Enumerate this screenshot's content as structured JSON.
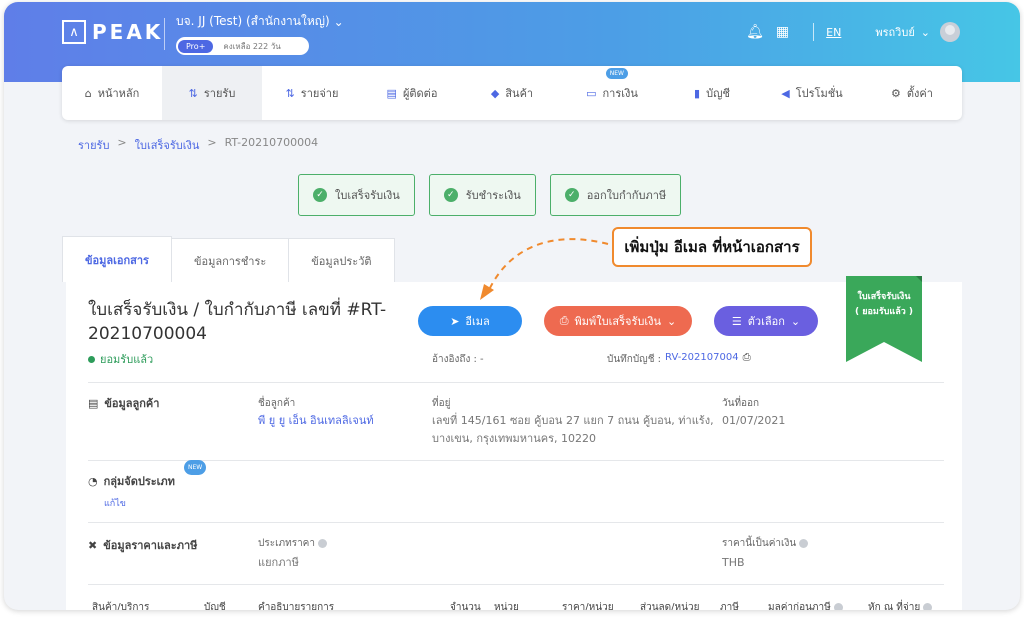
{
  "header": {
    "logo_text": "PEAK",
    "company_name": "บจ. JJ (Test) (สำนักงานใหญ่)",
    "plan_badge": "Pro+",
    "plan_remaining": "คงเหลือ 222 วัน",
    "language": "EN",
    "user_name": "พรถวิบย์"
  },
  "nav": {
    "items": [
      {
        "label": "หน้าหลัก",
        "icon": "home-icon"
      },
      {
        "label": "รายรับ",
        "icon": "income-icon"
      },
      {
        "label": "รายจ่าย",
        "icon": "expense-icon"
      },
      {
        "label": "ผู้ติดต่อ",
        "icon": "contacts-icon"
      },
      {
        "label": "สินค้า",
        "icon": "product-icon"
      },
      {
        "label": "การเงิน",
        "icon": "finance-icon",
        "badge": "NEW"
      },
      {
        "label": "บัญชี",
        "icon": "accounting-icon"
      },
      {
        "label": "โปรโมชั่น",
        "icon": "megaphone-icon"
      },
      {
        "label": "ตั้งค่า",
        "icon": "settings-icon"
      }
    ]
  },
  "breadcrumb": [
    "รายรับ",
    "ใบเสร็จรับเงิน",
    "RT-20210700004"
  ],
  "steps": [
    "ใบเสร็จรับเงิน",
    "รับชำระเงิน",
    "ออกใบกำกับภาษี"
  ],
  "tabs": [
    "ข้อมูลเอกสาร",
    "ข้อมูลการชำระ",
    "ข้อมูลประวัติ"
  ],
  "callout": "เพิ่มปุ่ม อีเมล ที่หน้าเอกสาร",
  "document": {
    "title": "ใบเสร็จรับเงิน / ใบกำกับภาษี เลขที่ #RT-20210700004",
    "status": "ยอมรับแล้ว",
    "ribbon_line1": "ใบเสร็จรับเงิน",
    "ribbon_line2": "( ยอมรับแล้ว )",
    "email_button": "อีเมล",
    "print_button": "พิมพ์ใบเสร็จรับเงิน",
    "options_button": "ตัวเลือก",
    "reference_label": "อ้างอิงถึง : -",
    "journal_label": "บันทึกบัญชี :",
    "journal_value": "RV-202107004"
  },
  "customer": {
    "section_title": "ข้อมูลลูกค้า",
    "name_label": "ชื่อลูกค้า",
    "name_value": "พี ยู ยู เอ็น อินเทลลิเจนท์",
    "address_label": "ที่อยู่",
    "address_line1": "เลขที่ 145/161 ซอย คู้บอน 27 แยก 7 ถนน คู้บอน, ท่าแร้ง,",
    "address_line2": "บางเขน, กรุงเทพมหานคร, 10220",
    "date_label": "วันที่ออก",
    "date_value": "01/07/2021"
  },
  "group": {
    "section_title": "กลุ่มจัดประเภท",
    "badge": "NEW",
    "edit_link": "แก้ไข"
  },
  "pricing": {
    "section_title": "ข้อมูลราคาและภาษี",
    "price_type_label": "ประเภทราคา",
    "price_type_value": "แยกภาษี",
    "currency_label": "ราคานี้เป็นค่าเงิน",
    "currency_value": "THB"
  },
  "table": {
    "columns": [
      "สินค้า/บริการ",
      "บัญชี",
      "คำอธิบายรายการ",
      "จำนวน",
      "หน่วย",
      "ราคา/หน่วย",
      "ส่วนลด/หน่วย",
      "ภาษี",
      "มูลค่าก่อนภาษี",
      "หัก ณ ที่จ่าย"
    ]
  },
  "colors": {
    "accent": "#4d68e3",
    "email": "#2c8df0",
    "print": "#ee6a50",
    "options": "#6a5fe0",
    "success": "#2d9c5a",
    "callout_border": "#f08a2e"
  }
}
